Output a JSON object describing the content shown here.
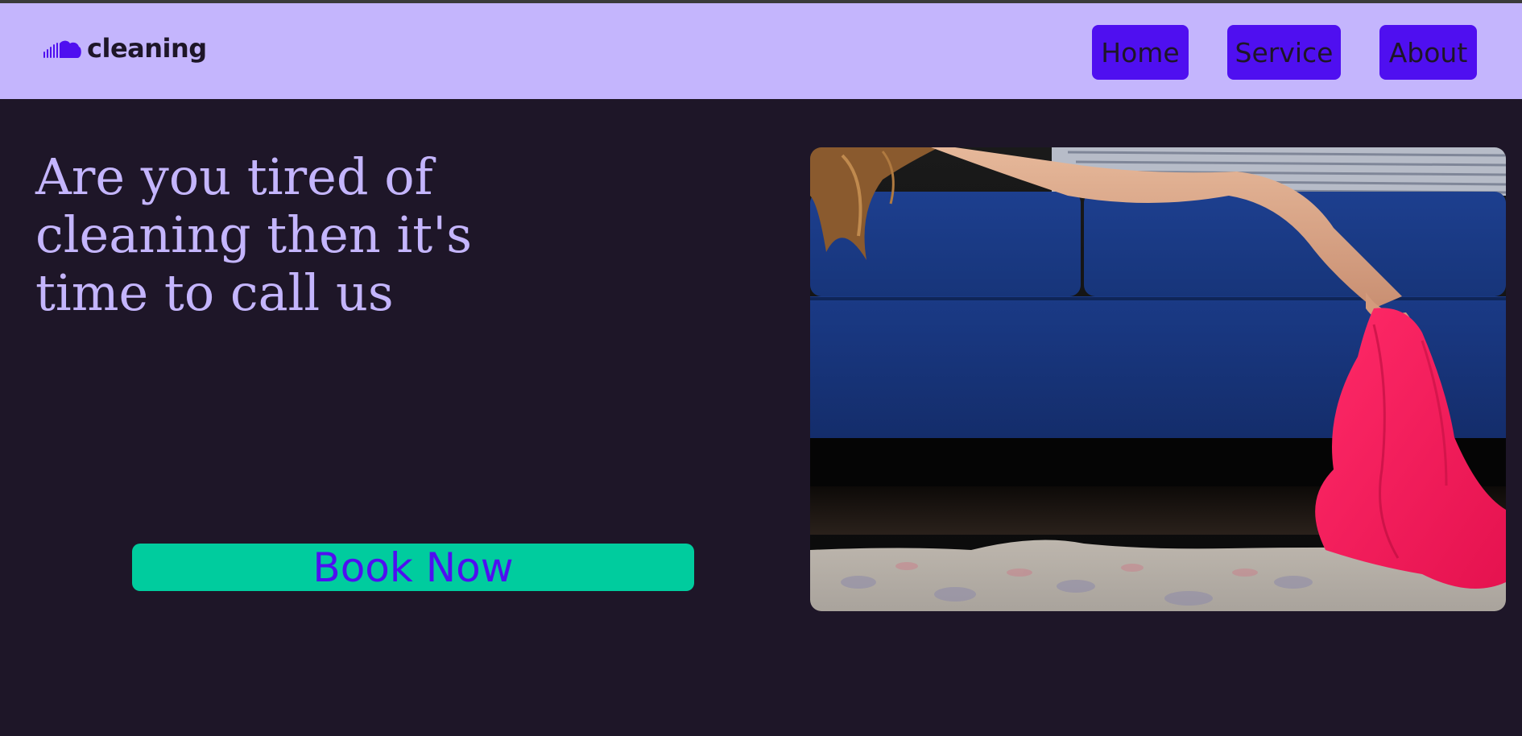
{
  "brand": {
    "name": "cleaning",
    "icon": "cloud-icon",
    "icon_color": "#4f0ff0"
  },
  "nav": {
    "items": [
      {
        "label": "Home"
      },
      {
        "label": "Service"
      },
      {
        "label": "About"
      }
    ],
    "button_color": "#4f0ff0"
  },
  "hero": {
    "headline": "Are you tired of cleaning then it's time to call us",
    "cta_label": "Book Now",
    "cta_color": "#00cc9e",
    "image_alt": "woman lying on blue sofa holding pink cloth"
  },
  "colors": {
    "navbar_bg": "#c4b5fd",
    "page_bg": "#1e1628",
    "headline": "#c4b5fd"
  }
}
